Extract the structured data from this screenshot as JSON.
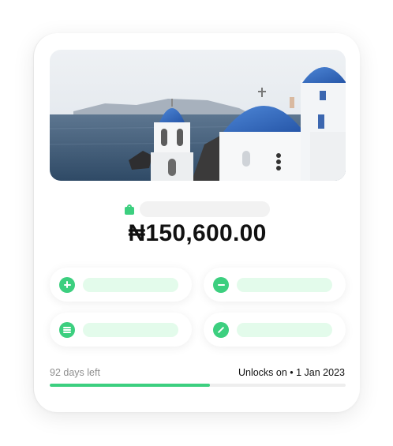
{
  "card": {
    "hero_image": "santorini-blue-domes-photo",
    "label_icon": "shopping-bag-icon",
    "amount": "₦150,600.00"
  },
  "actions": [
    {
      "icon": "plus-icon",
      "label": ""
    },
    {
      "icon": "minus-icon",
      "label": ""
    },
    {
      "icon": "list-icon",
      "label": ""
    },
    {
      "icon": "edit-icon",
      "label": ""
    }
  ],
  "footer": {
    "days_left": "92 days left",
    "unlocks_text": "Unlocks on • 1 Jan 2023",
    "progress_fraction": 0.54
  },
  "colors": {
    "accent": "#3ccf7f",
    "placeholder_green": "#e3fbeb",
    "placeholder_gray": "#f2f2f2"
  }
}
